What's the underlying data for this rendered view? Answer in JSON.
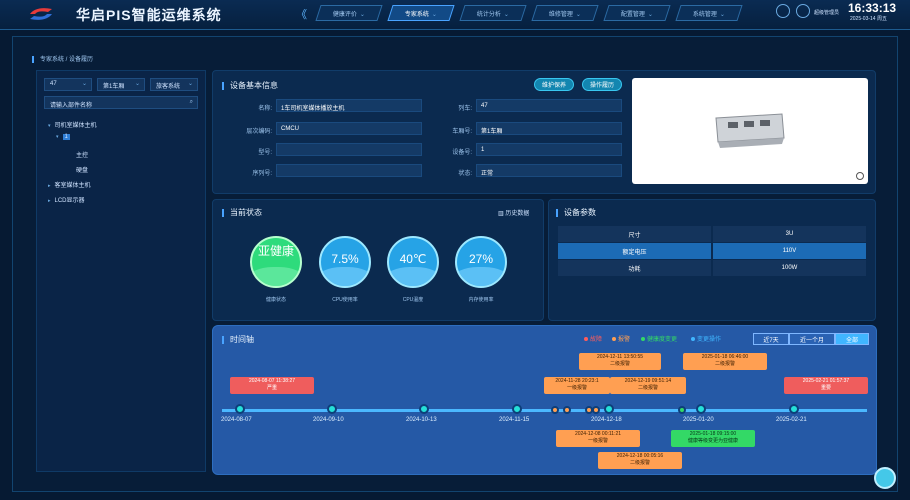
{
  "app": {
    "title": "华启PIS智能运维系统"
  },
  "nav": {
    "items": [
      {
        "label": "健康评价",
        "active": false
      },
      {
        "label": "专家系统",
        "active": true
      },
      {
        "label": "统计分析",
        "active": false
      },
      {
        "label": "维修管理",
        "active": false
      },
      {
        "label": "配置管理",
        "active": false
      },
      {
        "label": "系统管理",
        "active": false
      }
    ]
  },
  "header": {
    "user": "超级管理员",
    "time": "16:33:13",
    "date": "2025-03-14 周五"
  },
  "breadcrumb": "专家系统 / 设备履历",
  "filters": {
    "train": "47",
    "carriage": "第1车厢",
    "category": "旅客系统"
  },
  "search": {
    "placeholder": "请输入部件名称"
  },
  "tree": [
    {
      "label": "司机室媒体主机",
      "level": 0,
      "expanded": true
    },
    {
      "label": "1",
      "level": 1,
      "selected": true
    },
    {
      "label": "主控",
      "level": 2
    },
    {
      "label": "硬盘",
      "level": 2
    },
    {
      "label": "客室媒体主机",
      "level": 0
    },
    {
      "label": "LCD显示器",
      "level": 0
    }
  ],
  "basic_info": {
    "title": "设备基本信息",
    "btn_maintain": "维护保养",
    "btn_record": "操作履历",
    "fields": [
      {
        "label": "名称:",
        "value": "1车司机室媒体播放主机"
      },
      {
        "label": "列车:",
        "value": "47"
      },
      {
        "label": "层次编码:",
        "value": "CMCU"
      },
      {
        "label": "车厢号:",
        "value": "第1车厢"
      },
      {
        "label": "型号:",
        "value": ""
      },
      {
        "label": "设备号:",
        "value": "1"
      },
      {
        "label": "序列号:",
        "value": ""
      },
      {
        "label": "状态:",
        "value": "正常"
      }
    ]
  },
  "status": {
    "title": "当前状态",
    "history_link": "历史数据",
    "gauges": [
      {
        "value": "亚健康",
        "caption": "健康状态",
        "type": "health"
      },
      {
        "value": "7.5%",
        "caption": "CPU使用率",
        "level": 0.075
      },
      {
        "value": "40℃",
        "caption": "CPU温度"
      },
      {
        "value": "27%",
        "caption": "内存使用率",
        "level": 0.27
      }
    ]
  },
  "params": {
    "title": "设备参数",
    "rows": [
      [
        "尺寸",
        "3U"
      ],
      [
        "额定电压",
        "110V"
      ],
      [
        "功耗",
        "100W"
      ]
    ]
  },
  "timeline": {
    "title": "时间轴",
    "legend": [
      {
        "label": "故障",
        "color": "#ff5c5c"
      },
      {
        "label": "报警",
        "color": "#ff9f52"
      },
      {
        "label": "健康度变更",
        "color": "#33d966"
      },
      {
        "label": "变更操作",
        "color": "#40b6ff"
      }
    ],
    "ranges": [
      "近7天",
      "近一个月",
      "全部"
    ],
    "dates": [
      "2024-08-07",
      "2024-09-10",
      "2024-10-13",
      "2024-11-15",
      "2024-12-18",
      "2025-01-20",
      "2025-02-21"
    ],
    "events": [
      {
        "time": "2024-08-07 11:38:27",
        "text": "严重",
        "kind": "red"
      },
      {
        "time": "2024-12-11 13:50:55",
        "text": "二级报警",
        "kind": "org"
      },
      {
        "time": "2024-11-28 20:23:1",
        "text": "一级报警",
        "kind": "org"
      },
      {
        "time": "2024-12-19 09:51:14",
        "text": "二级报警",
        "kind": "org"
      },
      {
        "time": "2025-01-18 06:46:00",
        "text": "二级报警",
        "kind": "org"
      },
      {
        "time": "2025-02-21 01:57:37",
        "text": "重要",
        "kind": "red"
      },
      {
        "time": "2024-12-08 00:11:21",
        "text": "一级报警",
        "kind": "org"
      },
      {
        "time": "2025-01-18 09:15:00",
        "text": "健康等级变更为亚健康",
        "kind": "grn"
      },
      {
        "time": "2024-12-18 00:05:16",
        "text": "二级报警",
        "kind": "org"
      }
    ]
  }
}
